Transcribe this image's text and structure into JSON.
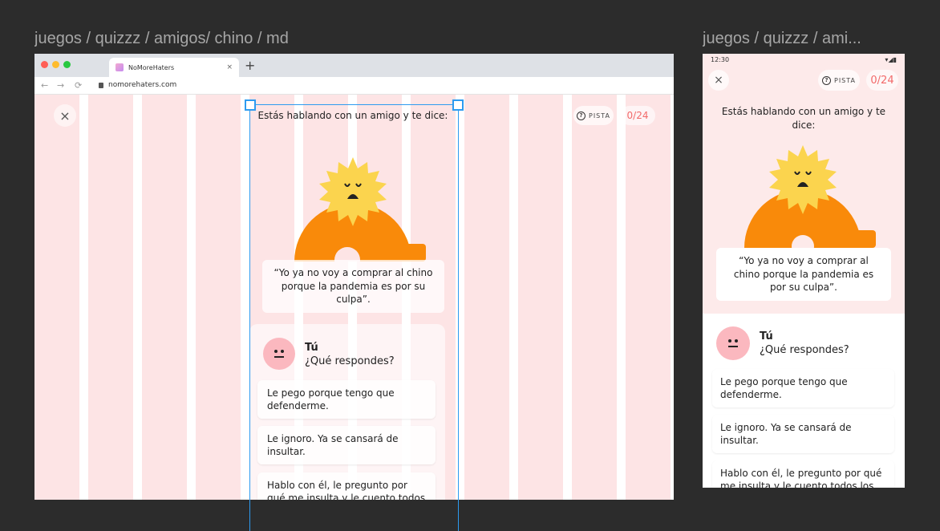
{
  "frames": {
    "desktop_label": "juegos / quizzz / amigos/ chino / md",
    "mobile_label": "juegos / quizzz / ami..."
  },
  "browser": {
    "tab_title": "NoMoreHaters",
    "tab_close": "×",
    "new_tab": "+",
    "url": "nomorehaters.com"
  },
  "mobile_status": {
    "time": "12:30"
  },
  "quiz": {
    "close_icon": "×",
    "hint_label": "PISTA",
    "hint_icon": "?",
    "counter": "0/24",
    "question": "Estás hablando con un amigo y te dice:",
    "quote": "“Yo ya no voy a comprar al chino porque la pandemia es por su culpa”.",
    "user_name": "Tú",
    "prompt": "¿Qué respondes?",
    "options": [
      "Le pego porque tengo que defenderme.",
      "Le ignoro. Ya se cansará de insultar.",
      "Hablo con él, le pregunto por qué me insulta y le cuento todos los"
    ]
  },
  "colors": {
    "column": "#fde4e5",
    "accent": "#f26a6a",
    "sun": "#fbd44e",
    "body": "#f98a0a",
    "avatar": "#fbb8bf",
    "selection": "#2d9bf0"
  }
}
